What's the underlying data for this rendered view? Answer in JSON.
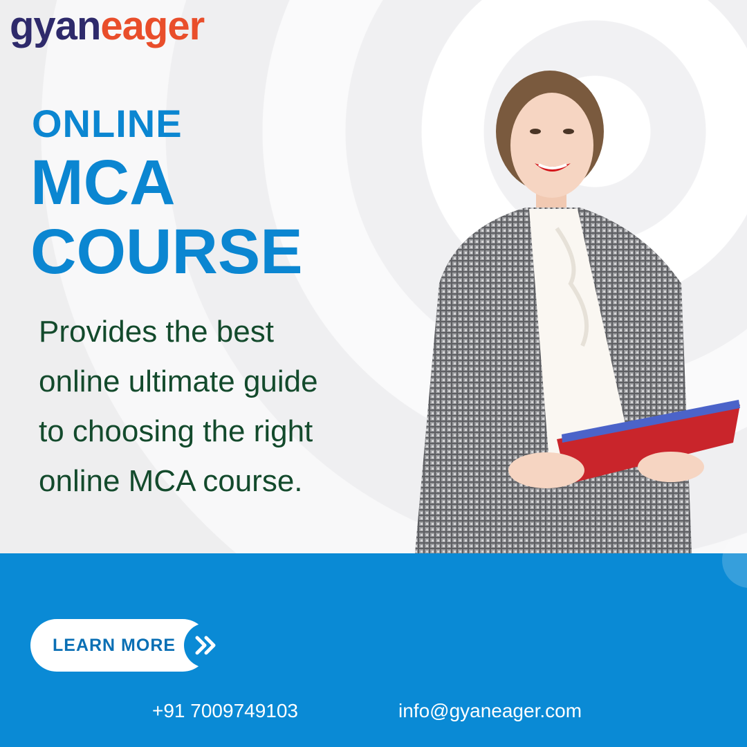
{
  "brand": {
    "part1": "gyan",
    "part2": "eager",
    "color1": "#2e2a6b",
    "color2": "#e94e2b"
  },
  "headline": {
    "line1": "ONLINE",
    "line2": "MCA",
    "line3": "COURSE",
    "color": "#0b86d1"
  },
  "description": {
    "lines": [
      "Provides the best",
      "online ultimate guide",
      "to choosing the right",
      "online MCA course."
    ],
    "color": "#134a2c"
  },
  "cta": {
    "label": "LEARN MORE",
    "icon": "double-chevron-right-icon"
  },
  "contact": {
    "phone": "+91 7009749103",
    "email": "info@gyaneager.com"
  },
  "colors": {
    "accent": "#0a8ad5"
  }
}
